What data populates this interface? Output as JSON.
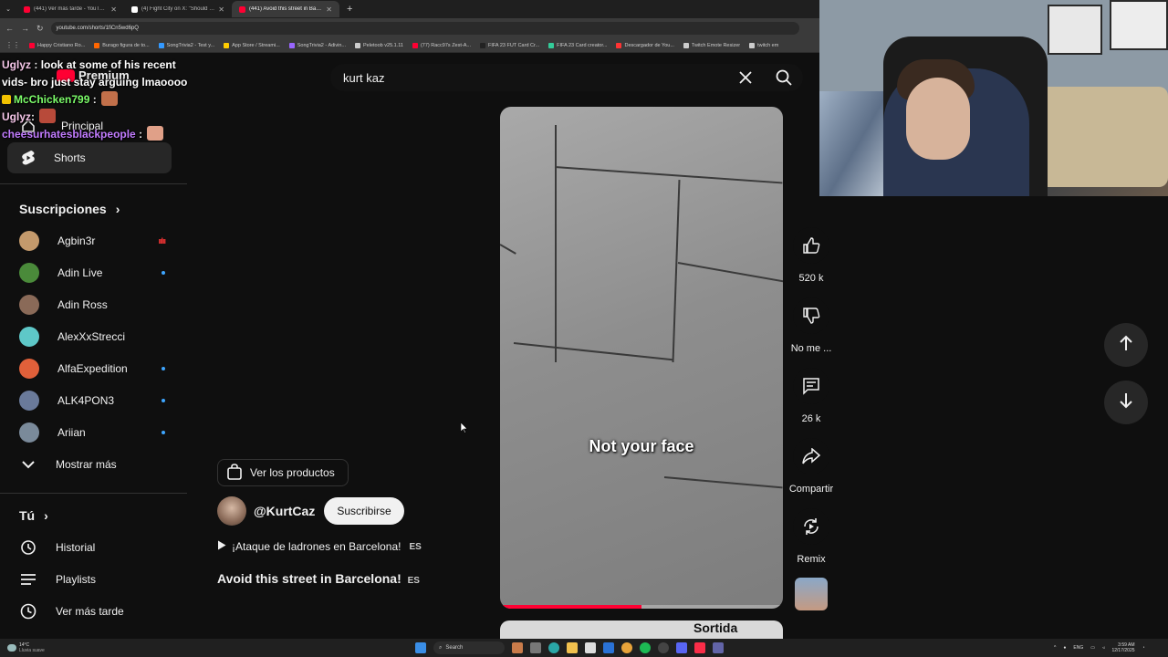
{
  "browser": {
    "tabs": [
      {
        "title": "(441) Ver más tarde - YouTube",
        "color": "#ff0033"
      },
      {
        "title": "(4) Fight City on X: \"Should le...",
        "color": "#ffffff"
      },
      {
        "title": "(441) Avoid this street in Barc...",
        "color": "#ff0033",
        "active": true
      }
    ],
    "new_tab": "+",
    "url": "youtube.com/shorts/1fiCn5wd6pQ",
    "bookmarks": [
      {
        "label": "Happy Cristiano Ro...",
        "color": "#ff0033"
      },
      {
        "label": "Burago figura de to...",
        "color": "#ff6600"
      },
      {
        "label": "SongTrivia2 - Test y...",
        "color": "#3399ff"
      },
      {
        "label": "App Store / Streami...",
        "color": "#ffcc00"
      },
      {
        "label": "SongTrivia2 - Adivin...",
        "color": "#9966ff"
      },
      {
        "label": "Peletoob v25.1.11",
        "color": "#cccccc"
      },
      {
        "label": "(77) Racc97s Zest-A...",
        "color": "#ff0033"
      },
      {
        "label": "FIFA 23 FUT Card Cr...",
        "color": "#222222"
      },
      {
        "label": "FIFA 23 Card creator...",
        "color": "#33cc99"
      },
      {
        "label": "Descargador de You...",
        "color": "#ff3333"
      },
      {
        "label": "Twitch Emote Resizer",
        "color": "#cccccc"
      },
      {
        "label": "twitch em",
        "color": "#cccccc"
      }
    ]
  },
  "chat": [
    {
      "user": "Uglyz",
      "text": "look at some of his recent vids- bro just stay arguing lmaoooo",
      "color": "#f5c6e8"
    },
    {
      "user": "McChicken799",
      "text": "",
      "color": "#7cfc6a",
      "badge": true,
      "emote": "#c2704a"
    },
    {
      "user": "Uglyz",
      "text": "",
      "color": "#f5c6e8",
      "emote": "#b84a3a"
    },
    {
      "user": "cheesurhatesblackpeople",
      "text": "",
      "color": "#c27cff",
      "emote": "#e0a088"
    }
  ],
  "sidebar": {
    "brand_partial": "Premium",
    "principal": "Principal",
    "shorts": "Shorts",
    "subs_heading": "Suscripciones",
    "subs": [
      {
        "name": "Agbin3r",
        "live": "bars",
        "avatar": "#c49a6c"
      },
      {
        "name": "Adin Live",
        "live": "dot",
        "avatar": "#4a8a3a"
      },
      {
        "name": "Adin Ross",
        "live": "",
        "avatar": "#8a6a58"
      },
      {
        "name": "AlexXxStrecci",
        "live": "",
        "avatar": "#5ec8c8"
      },
      {
        "name": "AlfaExpedition",
        "live": "dot",
        "avatar": "#e0603a"
      },
      {
        "name": "ALK4PON3",
        "live": "dot",
        "avatar": "#6a7a9a"
      },
      {
        "name": "Ariian",
        "live": "dot",
        "avatar": "#7a8a9a"
      }
    ],
    "show_more": "Mostrar más",
    "you_heading": "Tú",
    "you_items": [
      {
        "label": "Historial",
        "icon": "history-icon"
      },
      {
        "label": "Playlists",
        "icon": "playlists-icon"
      },
      {
        "label": "Ver más tarde",
        "icon": "watch-later-icon"
      }
    ]
  },
  "search": {
    "value": "kurt kaz"
  },
  "short": {
    "caption": "Not your face",
    "progress": 0.5,
    "products_label": "Ver los productos",
    "channel": "@KurtCaz",
    "subscribe": "Suscribirse",
    "sound": "¡Ataque de ladrones en Barcelona!",
    "lang": "ES",
    "title": "Avoid this street in Barcelona!",
    "next_label": "Sortida"
  },
  "actions": {
    "likes": "520 k",
    "dislike": "No me ...",
    "comments": "26 k",
    "share": "Compartir",
    "remix": "Remix"
  },
  "taskbar": {
    "temp": "14°C",
    "weather": "Lluvia suave",
    "search": "Search",
    "lang": "ENG",
    "time": "3:59 AM",
    "date": "12/17/2025"
  }
}
